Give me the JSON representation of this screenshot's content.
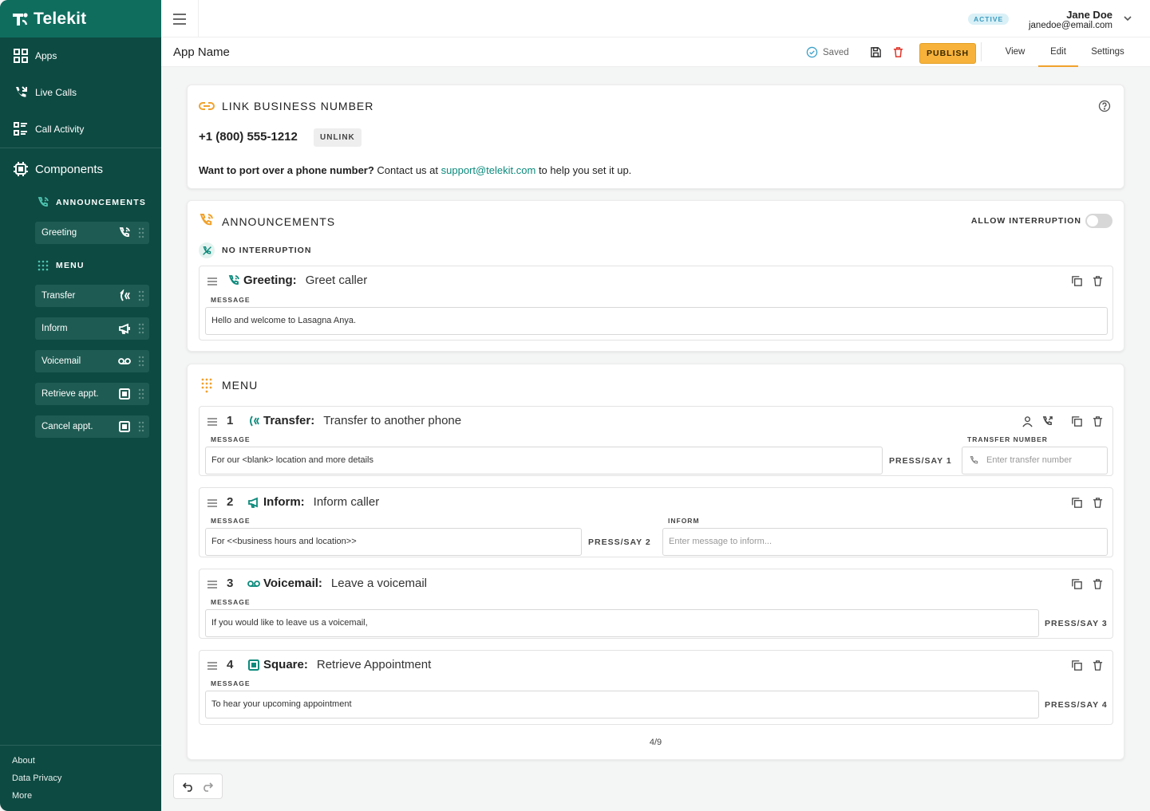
{
  "brand": {
    "name": "Telekit"
  },
  "sidebar": {
    "nav": [
      {
        "label": "Apps",
        "icon": "apps-grid-icon"
      },
      {
        "label": "Live Calls",
        "icon": "live-calls-icon"
      },
      {
        "label": "Call Activity",
        "icon": "call-activity-icon"
      }
    ],
    "components_label": "Components",
    "announcements_label": "ANNOUNCEMENTS",
    "announcement_items": [
      {
        "label": "Greeting",
        "icon": "phone-ring-icon"
      }
    ],
    "menu_label": "MENU",
    "menu_items": [
      {
        "label": "Transfer",
        "icon": "transfer-icon"
      },
      {
        "label": "Inform",
        "icon": "megaphone-icon"
      },
      {
        "label": "Voicemail",
        "icon": "voicemail-icon"
      },
      {
        "label": "Retrieve appt.",
        "icon": "square-icon"
      },
      {
        "label": "Cancel appt.",
        "icon": "square-icon"
      }
    ],
    "footer": [
      "About",
      "Data Privacy",
      "More"
    ]
  },
  "header": {
    "status_badge": "ACTIVE",
    "user_name": "Jane Doe",
    "user_email": "janedoe@email.com"
  },
  "appbar": {
    "app_name": "App Name",
    "saved_label": "Saved",
    "publish_label": "PUBLISH",
    "tabs": [
      "View",
      "Edit",
      "Settings"
    ],
    "active_tab": "Edit"
  },
  "link_card": {
    "title": "LINK BUSINESS NUMBER",
    "phone": "+1 (800) 555-1212",
    "unlink_label": "UNLINK",
    "port_bold": "Want to port over a phone number?",
    "port_mid": " Contact us at ",
    "port_link": "support@telekit.com",
    "port_end": " to help you set it up."
  },
  "announcements_card": {
    "title": "ANNOUNCEMENTS",
    "allow_label": "ALLOW INTERRUPTION",
    "allow_on": false,
    "no_interruption_label": "NO INTERRUPTION",
    "greeting": {
      "kind": "Greeting:",
      "desc": "Greet caller",
      "message_label": "MESSAGE",
      "message": "Hello and welcome to Lasagna Anya."
    }
  },
  "menu_card": {
    "title": "MENU",
    "items": [
      {
        "num": "1",
        "kind": "Transfer:",
        "desc": "Transfer to another phone",
        "message_label": "MESSAGE",
        "message": "For our <blank> location and more details",
        "press": "PRESS/SAY 1",
        "extra_label": "TRANSFER NUMBER",
        "extra_placeholder": "Enter transfer number"
      },
      {
        "num": "2",
        "kind": "Inform:",
        "desc": "Inform caller",
        "message_label": "MESSAGE",
        "message": "For <<business hours and location>>",
        "press": "PRESS/SAY 2",
        "extra_label": "INFORM",
        "extra_placeholder": "Enter message to inform..."
      },
      {
        "num": "3",
        "kind": "Voicemail:",
        "desc": "Leave a voicemail",
        "message_label": "MESSAGE",
        "message": "If you would like to leave us a voicemail,",
        "press": "PRESS/SAY 3"
      },
      {
        "num": "4",
        "kind": "Square:",
        "desc": "Retrieve Appointment",
        "message_label": "MESSAGE",
        "message": "To hear your upcoming appointment",
        "press": "PRESS/SAY 4"
      }
    ],
    "pager": "4/9"
  },
  "colors": {
    "sidebar": "#0d4a42",
    "brand_bar": "#0f6d5e",
    "accent": "#f7b23b",
    "teal": "#0c8a7c"
  }
}
